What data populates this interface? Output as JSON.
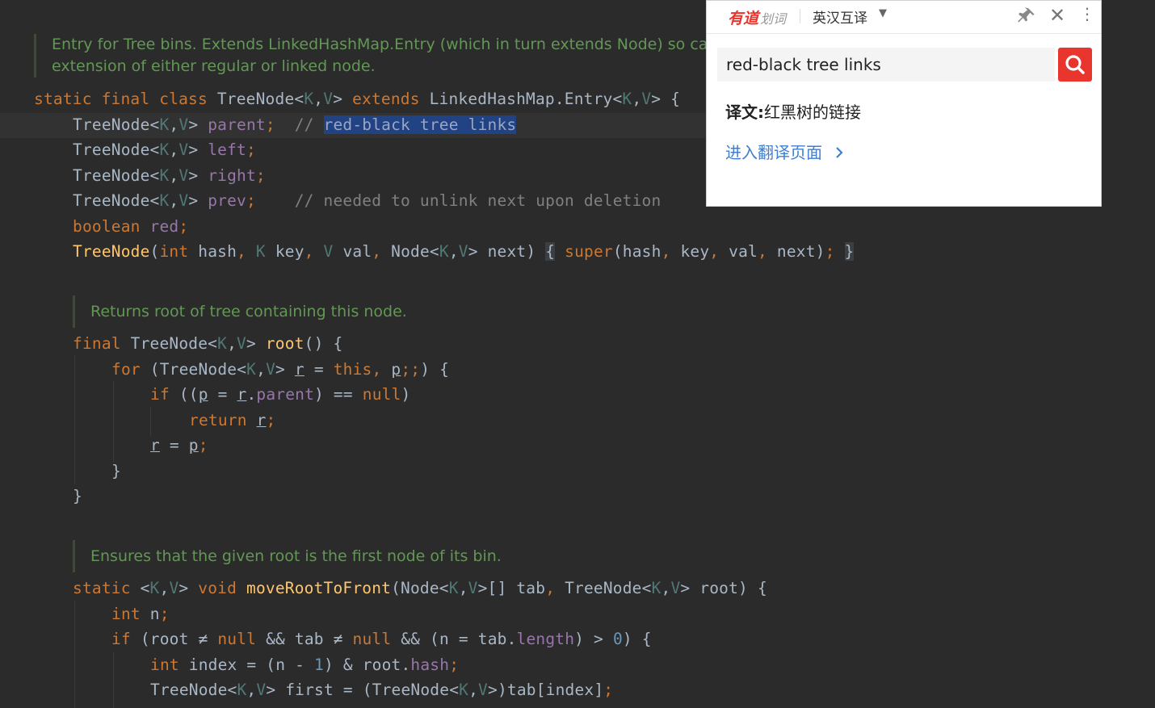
{
  "editor": {
    "doc1": [
      "Entry for Tree bins. Extends LinkedHashMap.Entry (which in turn extends Node) so can b",
      "extension of either regular or linked node."
    ],
    "doc2": "Returns root of tree containing this node.",
    "doc3": "Ensures that the given root is the first node of its bin.",
    "selected_comment": "red-black tree links",
    "comment_prev": "needed to unlink next upon deletion"
  },
  "popup": {
    "brand": "有道",
    "brand_sub": "划词",
    "language": "英汉互译",
    "search_value": "red-black tree links",
    "translation_label": "译文:",
    "translation_value": "红黑树的链接",
    "goto_link": "进入翻译页面"
  },
  "colors": {
    "editor_bg": "#2b2b2b",
    "keyword": "#cc7832",
    "doc_comment": "#629755",
    "selection": "#214283",
    "brand_red": "#e8352e",
    "link_blue": "#3f7fd0"
  }
}
